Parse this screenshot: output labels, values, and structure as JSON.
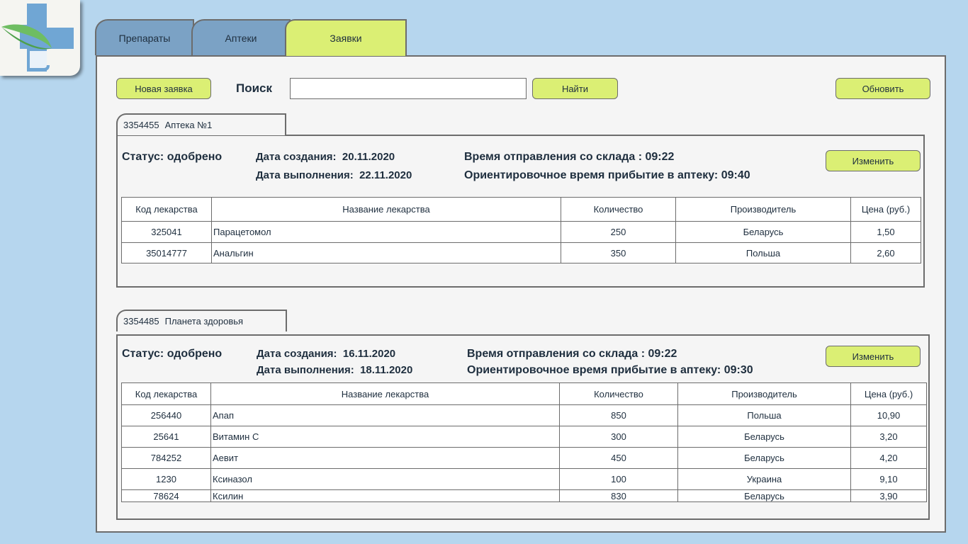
{
  "tabs": [
    "Препараты",
    "Аптеки",
    "Заявки"
  ],
  "toolbar": {
    "new_order": "Новая заявка",
    "search_label": "Поиск",
    "search_value": "",
    "find": "Найти",
    "refresh": "Обновить"
  },
  "columns": [
    "Код лекарства",
    "Название лекарства",
    "Количество",
    "Производитель",
    "Цена (руб.)"
  ],
  "orders": [
    {
      "id": "3354455",
      "pharmacy": "Аптека №1",
      "status": "Статус: одобрено",
      "created_label": "Дата создания:",
      "created": "20.11.2020",
      "completed_label": "Дата выполнения:",
      "completed": "22.11.2020",
      "departure": "Время отправления со склада : 09:22",
      "arrival": "Ориентировочное время прибытие в аптеку: 09:40",
      "edit": "Изменить",
      "rows": [
        [
          "325041",
          "Парацетомол",
          "250",
          "Беларусь",
          "1,50"
        ],
        [
          "35014777",
          "Анальгин",
          "350",
          "Польша",
          "2,60"
        ]
      ]
    },
    {
      "id": "3354485",
      "pharmacy": "Планета здоровья",
      "status": "Статус: одобрено",
      "created_label": "Дата создания:",
      "created": "16.11.2020",
      "completed_label": "Дата выполнения:",
      "completed": "18.11.2020",
      "departure": "Время отправления со склада : 09:22",
      "arrival": "Ориентировочное время прибытие в аптеку: 09:30",
      "edit": "Изменить",
      "rows": [
        [
          "256440",
          "Апап",
          "850",
          "Польша",
          "10,90"
        ],
        [
          "25641",
          "Витамин С",
          "300",
          "Беларусь",
          "3,20"
        ],
        [
          "784252",
          "Аевит",
          "450",
          "Беларусь",
          "4,20"
        ],
        [
          "1230",
          "Ксиназол",
          "100",
          "Украина",
          "9,10"
        ],
        [
          "78624",
          "Ксилин",
          "830",
          "Беларусь",
          "3,90"
        ]
      ]
    }
  ],
  "colors": {
    "background": "#b6d6ee",
    "accent": "#dbef74",
    "inactive_tab": "#7ba2c5",
    "panel": "#f5f5f5"
  },
  "icons": {
    "logo": "medical-cross-leaf-icon"
  }
}
